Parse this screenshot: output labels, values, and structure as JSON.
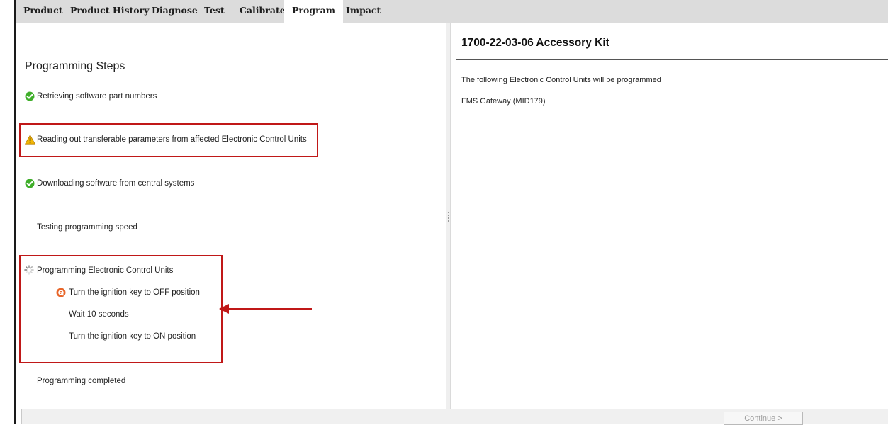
{
  "tabs": [
    {
      "label": "Product"
    },
    {
      "label": "Product History"
    },
    {
      "label": "Diagnose"
    },
    {
      "label": "Test"
    },
    {
      "label": "Calibrate"
    },
    {
      "label": "Program"
    },
    {
      "label": "Impact"
    }
  ],
  "active_tab": "Program",
  "left": {
    "title": "Programming Steps",
    "steps": [
      {
        "label": "Retrieving software part numbers",
        "status": "done"
      },
      {
        "label": "Reading out transferable parameters from affected Electronic Control Units",
        "status": "warning"
      },
      {
        "label": "Downloading software from central systems",
        "status": "done"
      },
      {
        "label": "Testing programming speed",
        "status": "pending"
      },
      {
        "label": "Programming Electronic Control Units",
        "status": "in-progress"
      },
      {
        "label": "Turn the ignition key to OFF position",
        "status": "action-required"
      },
      {
        "label": "Wait 10 seconds",
        "status": "pending"
      },
      {
        "label": "Turn the ignition key to ON position",
        "status": "pending"
      },
      {
        "label": "Programming completed",
        "status": "pending"
      }
    ]
  },
  "right": {
    "title": "1700-22-03-06 Accessory Kit",
    "intro": "The following Electronic Control Units will be programmed",
    "ecu": "FMS Gateway (MID179)"
  },
  "footer": {
    "continue_label": "Continue >"
  },
  "colors": {
    "highlight": "#c01818",
    "check": "#3fae2a",
    "warning": "#f2b705",
    "action": "#e8662a"
  },
  "icons": {
    "done": "check-circle-icon",
    "warning": "warning-triangle-icon",
    "in-progress": "spinner-icon",
    "action-required": "action-circle-icon"
  }
}
